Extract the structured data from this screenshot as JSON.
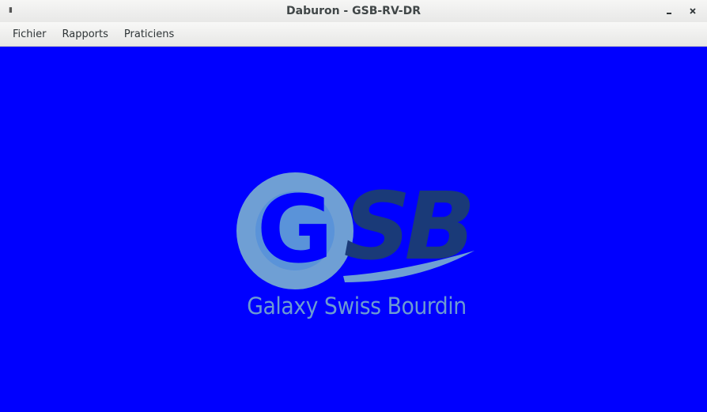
{
  "window": {
    "title": "Daburon - GSB-RV-DR",
    "minimize_glyph": "_",
    "close_glyph": "×"
  },
  "menubar": {
    "items": [
      "Fichier",
      "Rapports",
      "Praticiens"
    ]
  },
  "logo": {
    "letters_g": "G",
    "letters_sb": "SB",
    "caption": "Galaxy Swiss Bourdin",
    "colors": {
      "light": "#6f9fd4",
      "dark": "#1a3a78",
      "background": "#0000ff"
    }
  }
}
